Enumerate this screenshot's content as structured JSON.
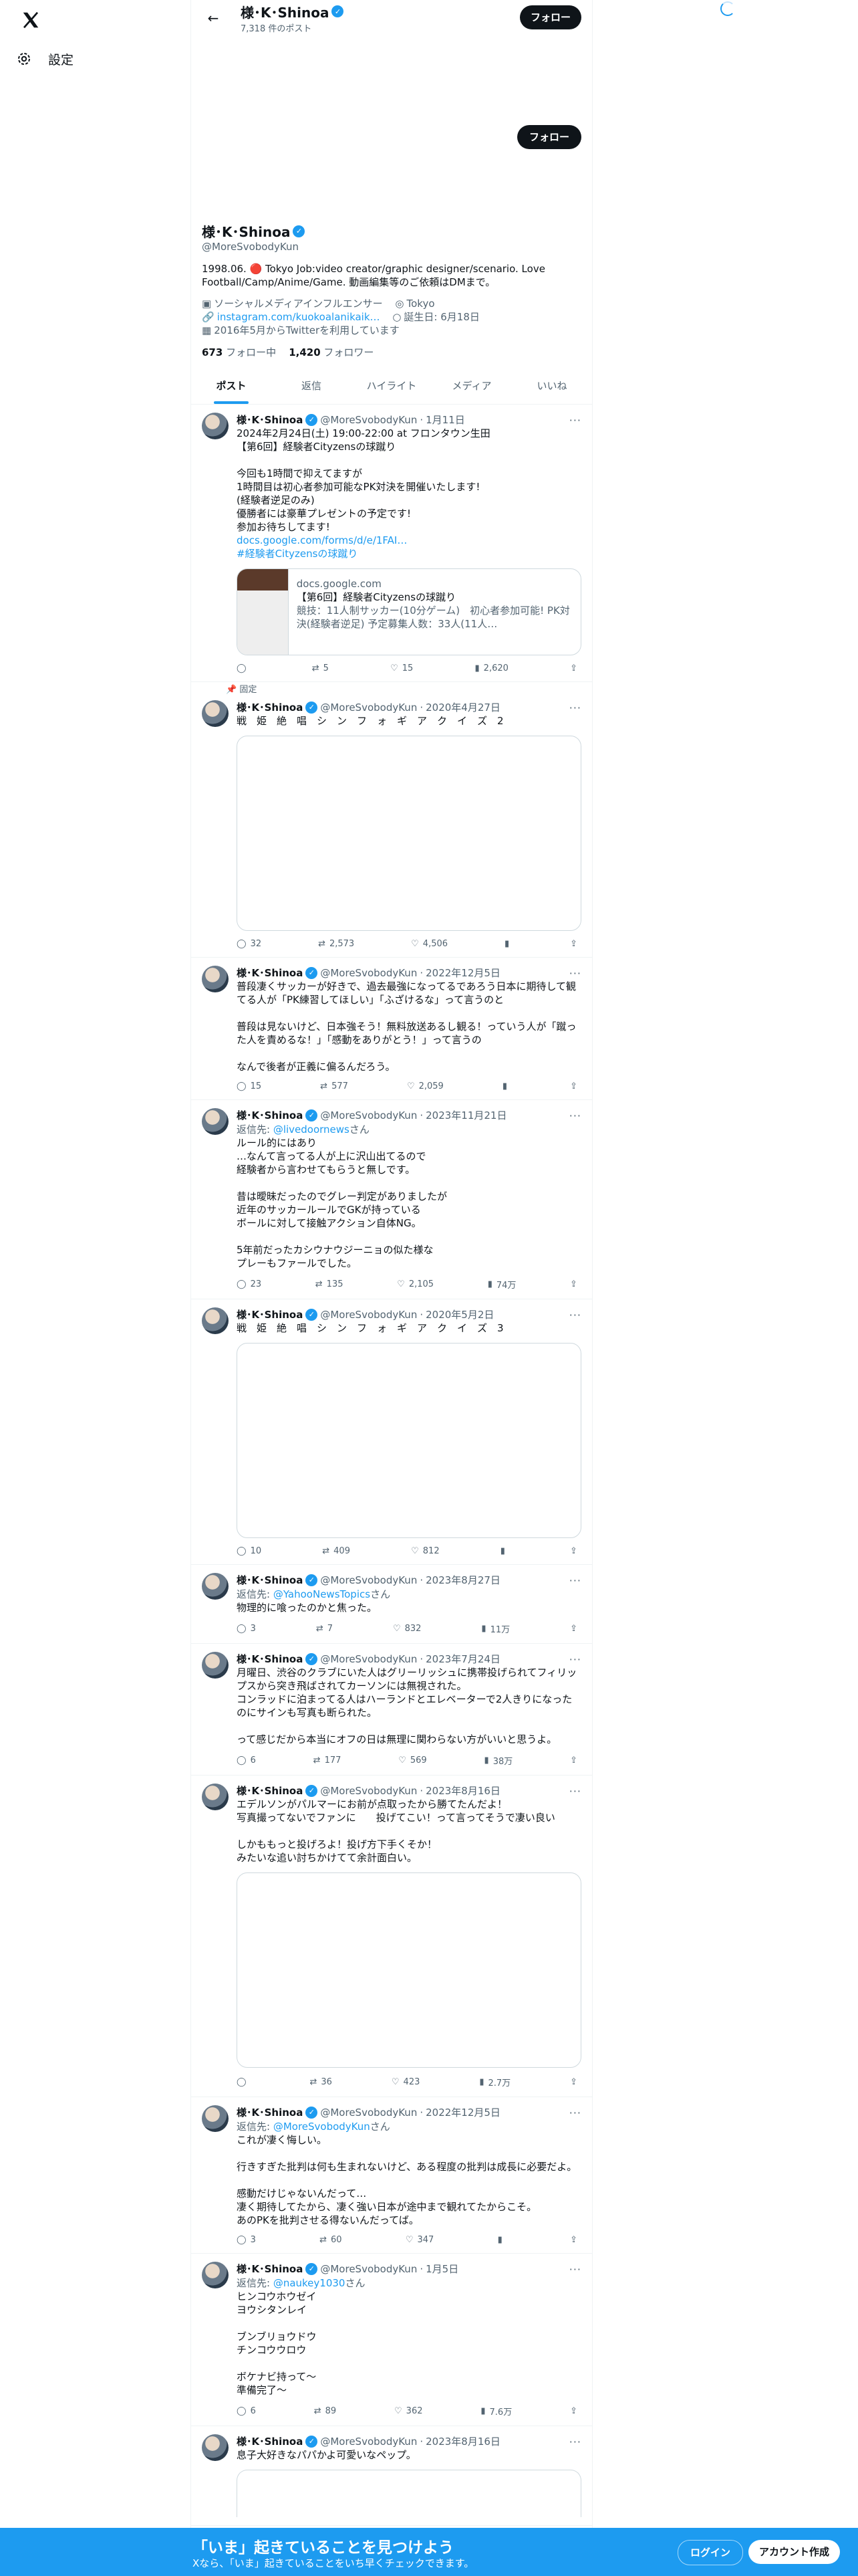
{
  "nav": {
    "settings_label": "設定"
  },
  "header": {
    "name": "様･K･Shinoa",
    "post_count": "7,318 件のポスト",
    "follow_label": "フォロー"
  },
  "profile": {
    "name": "様･K･Shinoa",
    "handle": "@MoreSvobodyKun",
    "follow_label": "フォロー",
    "bio": "1998.06. 🔴 Tokyo Job:video creator/graphic designer/scenario. Love Football/Camp/Anime/Game. 動画編集等のご依頼はDMまで。",
    "category": "ソーシャルメディアインフルエンサー",
    "location": "Tokyo",
    "website": "instagram.com/kuokoalanikaik…",
    "birthday": "誕生日: 6月18日",
    "joined": "2016年5月からTwitterを利用しています",
    "following_count": "673",
    "following_label": "フォロー中",
    "followers_count": "1,420",
    "followers_label": "フォロワー"
  },
  "tabs": [
    "ポスト",
    "返信",
    "ハイライト",
    "メディア",
    "いいね"
  ],
  "pinned_label": "固定",
  "tweets": [
    {
      "name": "様･K･Shinoa",
      "handle": "@MoreSvobodyKun",
      "date": "1月11日",
      "text": "2024年2月24日(土) 19:00-22:00 at フロンタウン生田\n【第6回】経験者Cityzensの球蹴り\n\n今回も1時間で抑えてますが\n1時間目は初心者参加可能なPK対決を開催いたします!\n(経験者逆足のみ)\n優勝者には豪華プレゼントの予定です!\n参加お待ちしてます!",
      "link": "docs.google.com/forms/d/e/1FAI…",
      "hashtag": "#経験者Cityzensの球蹴り",
      "card_domain": "docs.google.com",
      "card_title": "【第6回】経験者Cityzensの球蹴り",
      "card_desc": "競技：11人制サッカー(10分ゲーム)　初心者参加可能! PK対決(経験者逆足) 予定募集人数：33人(11人…",
      "replies": "",
      "reposts": "5",
      "likes": "15",
      "views": "2,620"
    },
    {
      "name": "様･K･Shinoa",
      "handle": "@MoreSvobodyKun",
      "date": "2020年4月27日",
      "text": "戦　姫　絶　唱　シ　ン　フ　ォ　ギ　ア　ク　イ　ズ　2",
      "replies": "32",
      "reposts": "2,573",
      "likes": "4,506",
      "views": ""
    },
    {
      "name": "様･K･Shinoa",
      "handle": "@MoreSvobodyKun",
      "date": "2022年12月5日",
      "text": "普段凄くサッカーが好きで、過去最強になってるであろう日本に期待して観てる人が「PK練習してほしい」「ふざけるな」って言うのと\n\n普段は見ないけど、日本強そう！無料放送あるし観る！っていう人が「蹴った人を責めるな！」「感動をありがとう！」って言うの\n\nなんで後者が正義に偏るんだろう。",
      "replies": "15",
      "reposts": "577",
      "likes": "2,059",
      "views": ""
    },
    {
      "name": "様･K･Shinoa",
      "handle": "@MoreSvobodyKun",
      "date": "2023年11月21日",
      "reply_to": "@livedoornews",
      "text": "ルール的にはあり\n…なんて言ってる人が上に沢山出てるので\n経験者から言わせてもらうと無しです。\n\n昔は曖昧だったのでグレー判定がありましたが\n近年のサッカールールでGKが持っている\nボールに対して接触アクション自体NG。\n\n5年前だったカシウナウジーニョの似た様な\nプレーもファールでした。",
      "replies": "23",
      "reposts": "135",
      "likes": "2,105",
      "views": "74万"
    },
    {
      "name": "様･K･Shinoa",
      "handle": "@MoreSvobodyKun",
      "date": "2020年5月2日",
      "text": "戦　姫　絶　唱　シ　ン　フ　ォ　ギ　ア　ク　イ　ズ　3",
      "replies": "10",
      "reposts": "409",
      "likes": "812",
      "views": ""
    },
    {
      "name": "様･K･Shinoa",
      "handle": "@MoreSvobodyKun",
      "date": "2023年8月27日",
      "reply_to": "@YahooNewsTopics",
      "text": "物理的に喰ったのかと焦った。",
      "replies": "3",
      "reposts": "7",
      "likes": "832",
      "views": "11万"
    },
    {
      "name": "様･K･Shinoa",
      "handle": "@MoreSvobodyKun",
      "date": "2023年7月24日",
      "text": "月曜日、渋谷のクラブにいた人はグリーリッシュに携帯投げられてフィリップスから突き飛ばされてカーソンには無視された。\nコンラッドに泊まってる人はハーランドとエレベーターで2人きりになったのにサインも写真も断られた。\n\nって感じだから本当にオフの日は無理に関わらない方がいいと思うよ。",
      "replies": "6",
      "reposts": "177",
      "likes": "569",
      "views": "38万"
    },
    {
      "name": "様･K･Shinoa",
      "handle": "@MoreSvobodyKun",
      "date": "2023年8月16日",
      "text": "エデルソンがパルマーにお前が点取ったから勝てたんだよ！\n写真撮ってないでファンに　　投げてこい！って言ってそうで凄い良い\n\nしかももっと投げろよ！投げ方下手くそか！\nみたいな追い討ちかけてて余計面白い。",
      "replies": "",
      "reposts": "36",
      "likes": "423",
      "views": "2.7万"
    },
    {
      "name": "様･K･Shinoa",
      "handle": "@MoreSvobodyKun",
      "date": "2022年12月5日",
      "reply_to": "@MoreSvobodyKun",
      "text": "これが凄く悔しい。\n\n行きすぎた批判は何も生まれないけど、ある程度の批判は成長に必要だよ。\n\n感動だけじゃないんだって…\n凄く期待してたから、凄く強い日本が途中まで観れてたからこそ。\nあのPKを批判させる得ないんだってば。",
      "replies": "3",
      "reposts": "60",
      "likes": "347",
      "views": ""
    },
    {
      "name": "様･K･Shinoa",
      "handle": "@MoreSvobodyKun",
      "date": "1月5日",
      "reply_to": "@naukey1030",
      "text": "ヒンコウホウゼイ\nヨウシタンレイ\n\nブンブリョウドウ\nチンコウウロウ\n\nボケナビ持って〜\n準備完了〜",
      "replies": "6",
      "reposts": "89",
      "likes": "362",
      "views": "7.6万"
    },
    {
      "name": "様･K･Shinoa",
      "handle": "@MoreSvobodyKun",
      "date": "2023年8月16日",
      "text": "息子大好きなパパかよ可愛いなペップ。"
    }
  ],
  "reply_prefix": "返信先: ",
  "reply_suffix": "さん",
  "bottom_bar": {
    "title": "「いま」起きていることを見つけよう",
    "subtitle": "Xなら、「いま」起きていることをいち早くチェックできます。",
    "login_label": "ログイン",
    "signup_label": "アカウント作成"
  }
}
